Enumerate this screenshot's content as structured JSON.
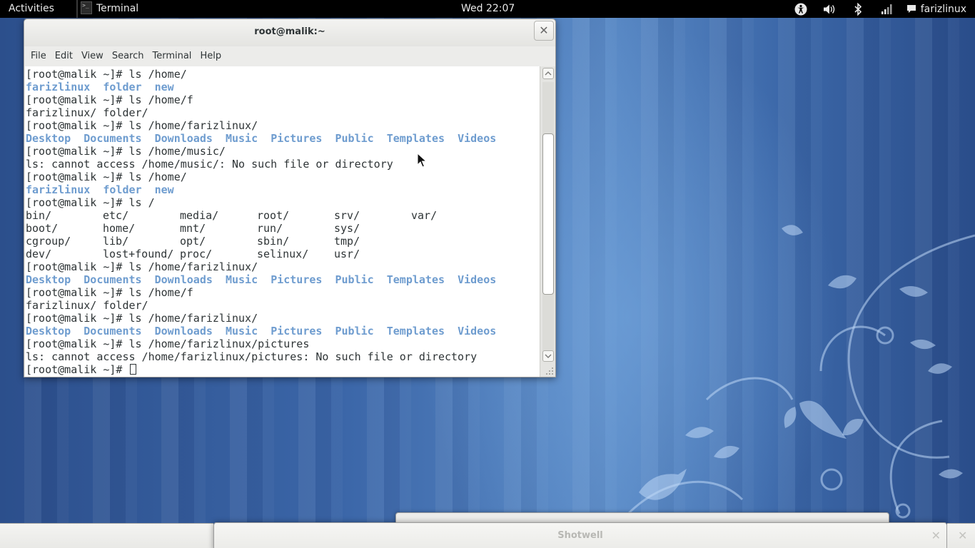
{
  "topbar": {
    "activities": "Activities",
    "app_name": "Terminal",
    "clock": "Wed 22:07",
    "user": "farizlinux",
    "icons": [
      "accessibility-icon",
      "volume-icon",
      "bluetooth-icon",
      "network-signal-icon",
      "chat-status-icon"
    ]
  },
  "terminal": {
    "title": "root@malik:~",
    "menu": [
      "File",
      "Edit",
      "View",
      "Search",
      "Terminal",
      "Help"
    ],
    "lines": [
      {
        "type": "text",
        "text": "[root@malik ~]# ls /home/"
      },
      {
        "type": "dirs",
        "items": [
          "farizlinux",
          "folder",
          "new"
        ]
      },
      {
        "type": "text",
        "text": "[root@malik ~]# ls /home/f"
      },
      {
        "type": "text",
        "text": "farizlinux/ folder/"
      },
      {
        "type": "text",
        "text": "[root@malik ~]# ls /home/farizlinux/"
      },
      {
        "type": "dirs",
        "items": [
          "Desktop",
          "Documents",
          "Downloads",
          "Music",
          "Pictures",
          "Public",
          "Templates",
          "Videos"
        ]
      },
      {
        "type": "text",
        "text": "[root@malik ~]# ls /home/music/"
      },
      {
        "type": "text",
        "text": "ls: cannot access /home/music/: No such file or directory"
      },
      {
        "type": "text",
        "text": "[root@malik ~]# ls /home/"
      },
      {
        "type": "dirs",
        "items": [
          "farizlinux",
          "folder",
          "new"
        ]
      },
      {
        "type": "text",
        "text": "[root@malik ~]# ls /"
      },
      {
        "type": "grid",
        "items": [
          "bin/",
          "etc/",
          "media/",
          "root/",
          "srv/",
          "var/",
          "boot/",
          "home/",
          "mnt/",
          "run/",
          "sys/",
          "",
          "cgroup/",
          "lib/",
          "opt/",
          "sbin/",
          "tmp/",
          "",
          "dev/",
          "lost+found/",
          "proc/",
          "selinux/",
          "usr/",
          ""
        ]
      },
      {
        "type": "text",
        "text": "[root@malik ~]# ls /home/farizlinux/"
      },
      {
        "type": "dirs",
        "items": [
          "Desktop",
          "Documents",
          "Downloads",
          "Music",
          "Pictures",
          "Public",
          "Templates",
          "Videos"
        ]
      },
      {
        "type": "text",
        "text": "[root@malik ~]# ls /home/f"
      },
      {
        "type": "text",
        "text": "farizlinux/ folder/"
      },
      {
        "type": "text",
        "text": "[root@malik ~]# ls /home/farizlinux/"
      },
      {
        "type": "dirs",
        "items": [
          "Desktop",
          "Documents",
          "Downloads",
          "Music",
          "Pictures",
          "Public",
          "Templates",
          "Videos"
        ]
      },
      {
        "type": "text",
        "text": "[root@malik ~]# ls /home/farizlinux/pictures"
      },
      {
        "type": "text",
        "text": "ls: cannot access /home/farizlinux/pictures: No such file or directory"
      },
      {
        "type": "prompt",
        "text": "[root@malik ~]# "
      }
    ],
    "scroll_position": 0.42,
    "colors": {
      "directory": "#6e9ccf",
      "text": "#2e3436",
      "background": "#ffffff"
    }
  },
  "windows": {
    "shotwell_title": "Shotwell",
    "close_glyph": "✕"
  }
}
